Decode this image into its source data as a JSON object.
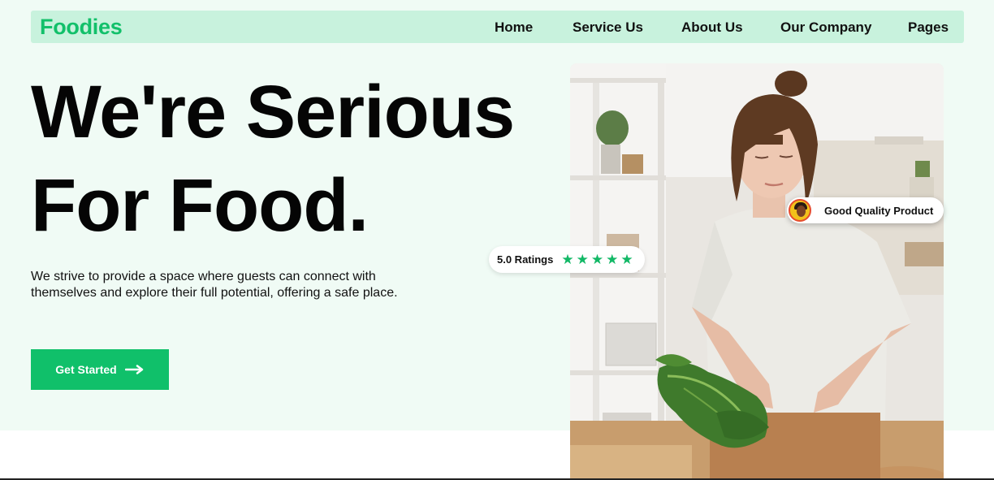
{
  "brand": {
    "logo": "Foodies",
    "accent": "#12c06a",
    "hero_bg": "#f0fbf5",
    "nav_bg": "#c8f2dd"
  },
  "nav": {
    "items": [
      "Home",
      "Service Us",
      "About Us",
      "Our Company",
      "Pages"
    ]
  },
  "hero": {
    "headline_line1": "We're Serious",
    "headline_line2": "For Food.",
    "description": "We strive to provide a space where guests can connect with themselves and explore their full potential, offering a safe place.",
    "cta_label": "Get Started",
    "cta_icon": "arrow-right-icon"
  },
  "badges": {
    "rating_label": "5.0 Ratings",
    "rating_stars": 5,
    "quality_label": "Good Quality Product"
  }
}
